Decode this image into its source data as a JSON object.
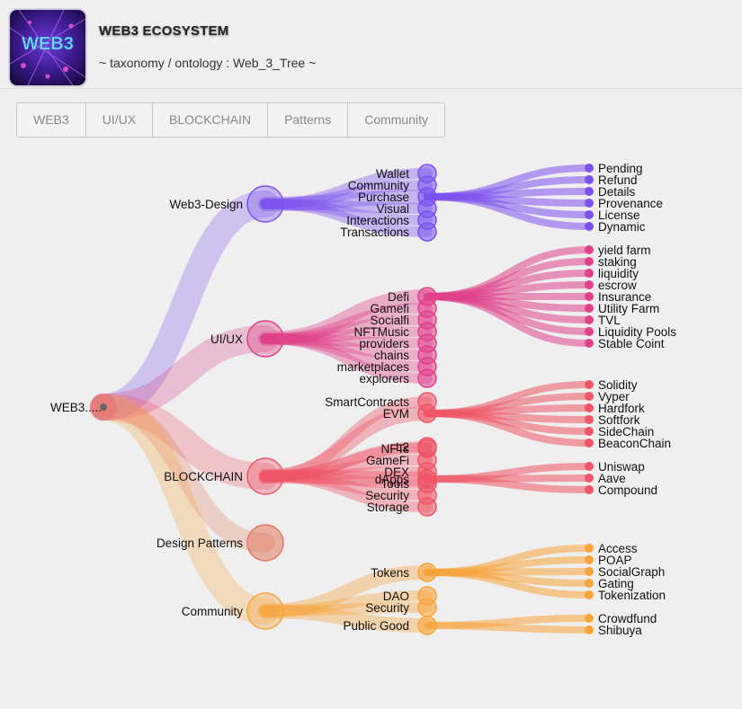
{
  "header": {
    "logo_text": "WEB3",
    "title": "WEB3 ECOSYSTEM",
    "subtitle": "~ taxonomy / ontology : Web_3_Tree ~"
  },
  "tabs": [
    "WEB3",
    "UI/UX",
    "BLOCKCHAIN",
    "Patterns",
    "Community"
  ],
  "tree": {
    "root": "WEB3.....",
    "branches": [
      {
        "label": "Web3-Design",
        "color": "#7b52ee",
        "children": [
          {
            "label": "Wallet"
          },
          {
            "label": "Community"
          },
          {
            "label": "Purchase",
            "children": [
              "Pending",
              "Refund",
              "Details",
              "Provenance",
              "License",
              "Dynamic"
            ]
          },
          {
            "label": "Visual"
          },
          {
            "label": "Interactions"
          },
          {
            "label": "Transactions"
          }
        ]
      },
      {
        "label": "UI/UX",
        "color": "#e0418a",
        "children": [
          {
            "label": "Defi",
            "children": [
              "yield farm",
              "staking",
              "liquidity",
              "escrow",
              "Insurance",
              "Utility Farm",
              "TVL",
              "Liquidity Pools",
              "Stable Coint"
            ]
          },
          {
            "label": "Gamefi"
          },
          {
            "label": "Socialfi"
          },
          {
            "label": "NFTMusic"
          },
          {
            "label": "providers"
          },
          {
            "label": "chains"
          },
          {
            "label": "marketplaces"
          },
          {
            "label": "explorers"
          }
        ]
      },
      {
        "label": "BLOCKCHAIN",
        "color": "#ef5566",
        "children": [
          {
            "label": "SmartContracts"
          },
          {
            "label": "EVM",
            "children": [
              "Solidity",
              "Vyper",
              "Hardfork",
              "Softfork",
              "SideChain",
              "BeaconChain"
            ]
          },
          {
            "label": "L2"
          },
          {
            "label": "dApps",
            "children": [
              "Uniswap",
              "Aave",
              "Compound"
            ]
          },
          {
            "label": "NFTs"
          },
          {
            "label": "GameFi"
          },
          {
            "label": "DEX"
          },
          {
            "label": "Tools"
          },
          {
            "label": "Security"
          },
          {
            "label": "Storage"
          }
        ]
      },
      {
        "label": "Design Patterns",
        "color": "#e2795f",
        "children": []
      },
      {
        "label": "Community",
        "color": "#f7a43b",
        "children": [
          {
            "label": "Tokens",
            "children": [
              "Access",
              "POAP",
              "SocialGraph",
              "Gating",
              "Tokenization"
            ]
          },
          {
            "label": "Public Good",
            "children": [
              "Crowdfund",
              "Shibuya"
            ]
          },
          {
            "label": "DAO"
          },
          {
            "label": "Security"
          }
        ]
      }
    ]
  }
}
